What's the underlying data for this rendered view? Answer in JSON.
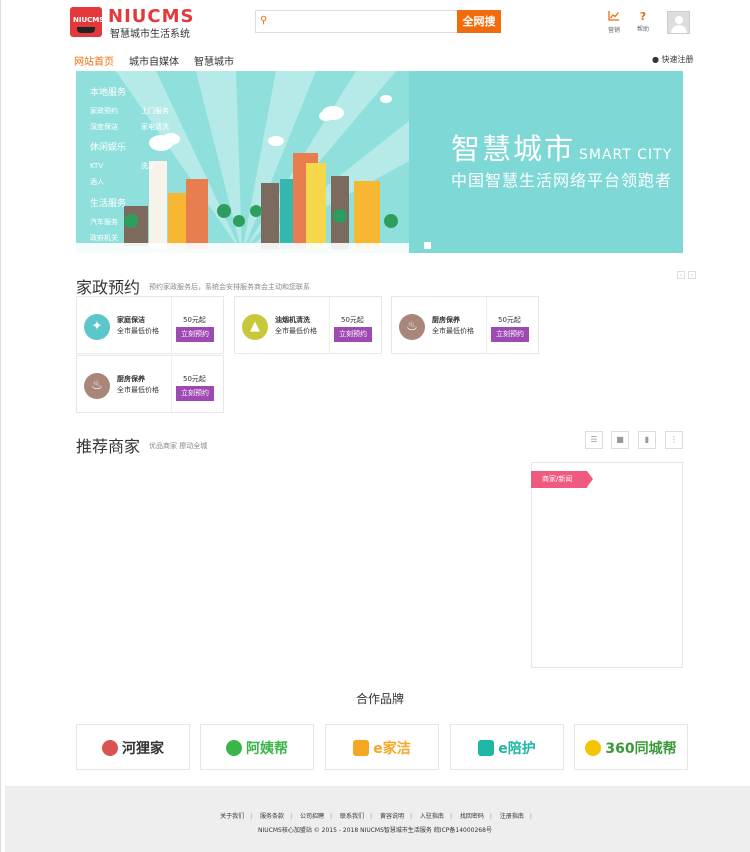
{
  "header": {
    "logo_mini": "NIUCMS",
    "logo_text": "NIUCMS",
    "logo_subtitle": "智慧城市生活系统",
    "search_placeholder": "",
    "search_button": "全网搜",
    "icon_links": [
      {
        "label": "营销",
        "icon": "chart-icon"
      },
      {
        "label": "帮助",
        "icon": "help-icon"
      }
    ]
  },
  "nav": {
    "items": [
      "网站首页",
      "城市自媒体",
      "智慧城市"
    ],
    "active_index": 0,
    "register": "快速注册"
  },
  "banner": {
    "menu": [
      {
        "title": "本地服务",
        "rows": [
          [
            "家政预约",
            "上门服务"
          ],
          [
            "深度保洁",
            "家电清洗"
          ]
        ]
      },
      {
        "title": "休闲娱乐",
        "rows": [
          [
            "KTV",
            "洗浴"
          ],
          [
            "酒人",
            ""
          ]
        ]
      },
      {
        "title": "生活服务",
        "rows": [
          [
            "汽车服务",
            ""
          ],
          [
            "政府机关",
            ""
          ]
        ]
      }
    ],
    "title": "智慧城市",
    "title_en": "SMART CITY",
    "subtitle": "中国智慧生活网络平台领跑者"
  },
  "housekeeping": {
    "title": "家政预约",
    "subtitle": "预约家政服务后，系统会安排服务商会主动和您联系",
    "pager_prev": "‹",
    "pager_next": "›",
    "cards": [
      {
        "name": "家庭保洁",
        "desc": "全市最低价格",
        "price": "50元起",
        "button": "立刻预约",
        "icon": "broom-icon",
        "color": "#5bc6cc"
      },
      {
        "name": "油烟机清洗",
        "desc": "全市最低价格",
        "price": "50元起",
        "button": "立刻预约",
        "icon": "range-hood-icon",
        "color": "#c8c83a"
      },
      {
        "name": "厨房保养",
        "desc": "全市最低价格",
        "price": "50元起",
        "button": "立刻预约",
        "icon": "kitchen-icon",
        "color": "#a8867a"
      },
      {
        "name": "厨房保养",
        "desc": "全市最低价格",
        "price": "50元起",
        "button": "立刻预约",
        "icon": "kitchen-icon",
        "color": "#a8867a"
      }
    ]
  },
  "merchants": {
    "title": "推荐商家",
    "subtitle": "优品商家  擦动全城",
    "filters": [
      "food-icon",
      "shop-icon",
      "drink-icon",
      "more-icon"
    ],
    "news_tag": "商家/新闻"
  },
  "partners": {
    "title": "合作品牌",
    "brands": [
      {
        "name": "河狸家",
        "color": "#333333",
        "icon_color": "#d9534f"
      },
      {
        "name": "阿姨帮",
        "color": "#3ab54a",
        "icon_color": "#3ab54a"
      },
      {
        "name": "e家洁",
        "color": "#f5a623",
        "icon_color": "#f5a623"
      },
      {
        "name": "e陪护",
        "color": "#1fb8a6",
        "icon_color": "#1fb8a6"
      },
      {
        "name": "360同城帮",
        "color": "#3a9a3a",
        "icon_color": "#f5c400"
      }
    ]
  },
  "footer": {
    "links": [
      "关于我们",
      "服务条款",
      "公司招聘",
      "联系我们",
      "黄容说明",
      "入驻指南",
      "找回密码",
      "注册指南"
    ],
    "copyright": "NIUCMS核心加盟站  © 2015 - 2018  NIUCMS智慧城市生活服务  皖ICP备14000268号"
  }
}
